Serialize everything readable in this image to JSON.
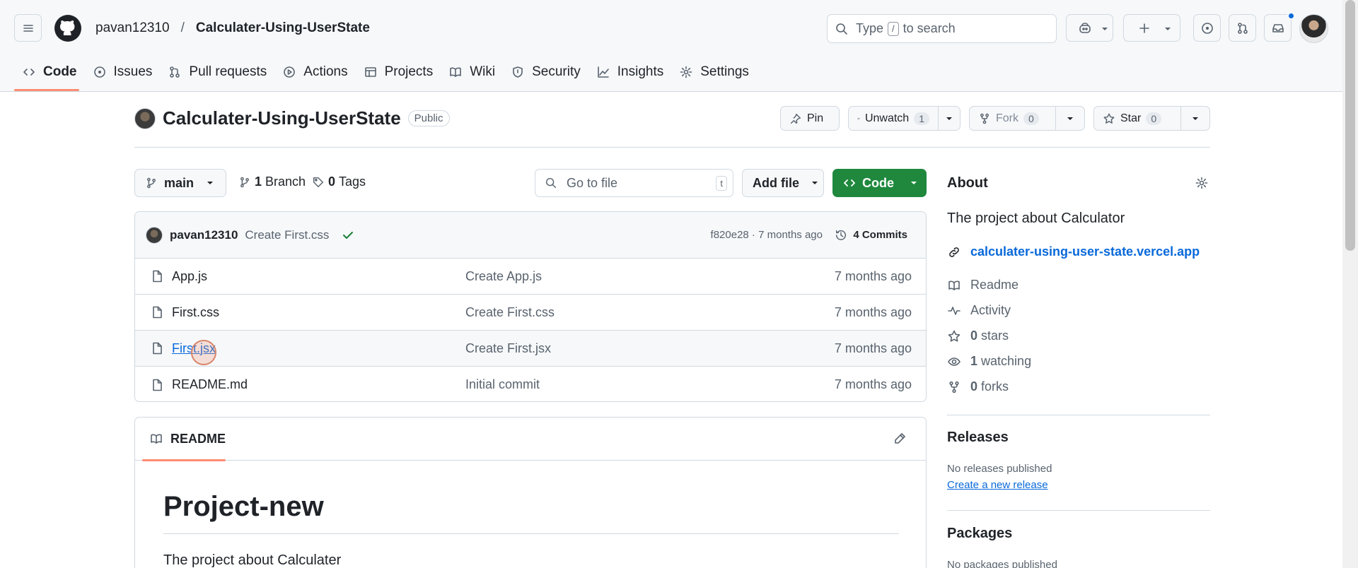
{
  "header": {
    "owner": "pavan12310",
    "separator": "/",
    "repo": "Calculater-Using-UserState",
    "search_prefix": "Type",
    "search_key": "/",
    "search_suffix": "to search"
  },
  "tabs": [
    {
      "label": "Code"
    },
    {
      "label": "Issues"
    },
    {
      "label": "Pull requests"
    },
    {
      "label": "Actions"
    },
    {
      "label": "Projects"
    },
    {
      "label": "Wiki"
    },
    {
      "label": "Security"
    },
    {
      "label": "Insights"
    },
    {
      "label": "Settings"
    }
  ],
  "repo_header": {
    "title": "Calculater-Using-UserState",
    "visibility": "Public",
    "pin_label": "Pin",
    "unwatch_label": "Unwatch",
    "watch_count": "1",
    "fork_label": "Fork",
    "fork_count": "0",
    "star_label": "Star",
    "star_count": "0"
  },
  "branch_bar": {
    "branch": "main",
    "branches_count": "1",
    "branches_label": "Branch",
    "tags_count": "0",
    "tags_label": "Tags",
    "goto_placeholder": "Go to file",
    "goto_key": "t",
    "add_file_label": "Add file",
    "code_label": "Code"
  },
  "latest_commit": {
    "author": "pavan12310",
    "message": "Create First.css",
    "hash_age": "f820e28 · 7 months ago",
    "commits_label": "4 Commits"
  },
  "files": [
    {
      "name": "App.js",
      "message": "Create App.js",
      "age": "7 months ago"
    },
    {
      "name": "First.css",
      "message": "Create First.css",
      "age": "7 months ago"
    },
    {
      "name": "First.jsx",
      "message": "Create First.jsx",
      "age": "7 months ago"
    },
    {
      "name": "README.md",
      "message": "Initial commit",
      "age": "7 months ago"
    }
  ],
  "readme": {
    "tab_label": "README",
    "heading": "Project-new",
    "paragraph": "The project about Calculater"
  },
  "about": {
    "title": "About",
    "description": "The project about Calculator",
    "website": "calculater-using-user-state.vercel.app",
    "readme": "Readme",
    "activity": "Activity",
    "stars_count": "0",
    "stars_label": "stars",
    "watching_count": "1",
    "watching_label": "watching",
    "forks_count": "0",
    "forks_label": "forks"
  },
  "releases": {
    "title": "Releases",
    "empty": "No releases published",
    "create_link": "Create a new release"
  },
  "packages": {
    "title": "Packages",
    "empty": "No packages published"
  },
  "colors": {
    "accent_green": "#1f883d",
    "link_blue": "#0969da",
    "tab_underline": "#fd8c73",
    "notification_dot": "#0969da"
  }
}
